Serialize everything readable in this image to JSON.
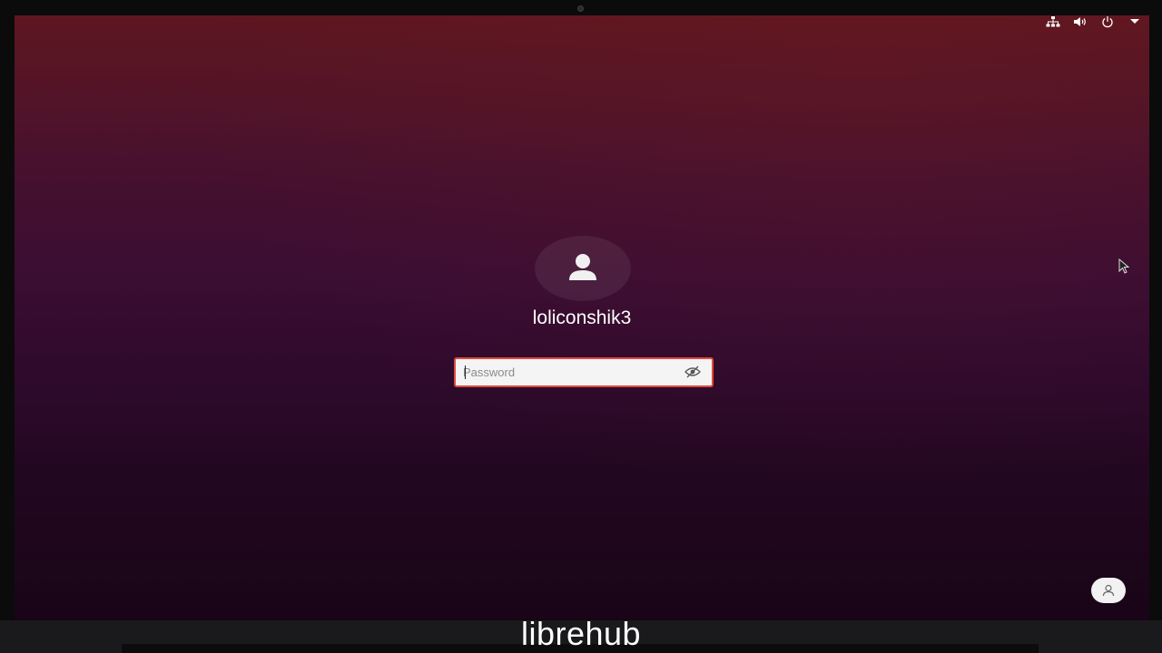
{
  "system": {
    "indicators": [
      {
        "icon": "network-icon"
      },
      {
        "icon": "volume-icon"
      },
      {
        "icon": "power-icon"
      },
      {
        "icon": "menu-chevron-down-icon"
      }
    ]
  },
  "login": {
    "username": "loliconshik3",
    "password_placeholder": "Password",
    "password_value": ""
  },
  "footer": {
    "watermark": "librehub"
  },
  "colors": {
    "background_top": "#5e1620",
    "background_bottom": "#190517",
    "input_border": "#e0493d"
  }
}
